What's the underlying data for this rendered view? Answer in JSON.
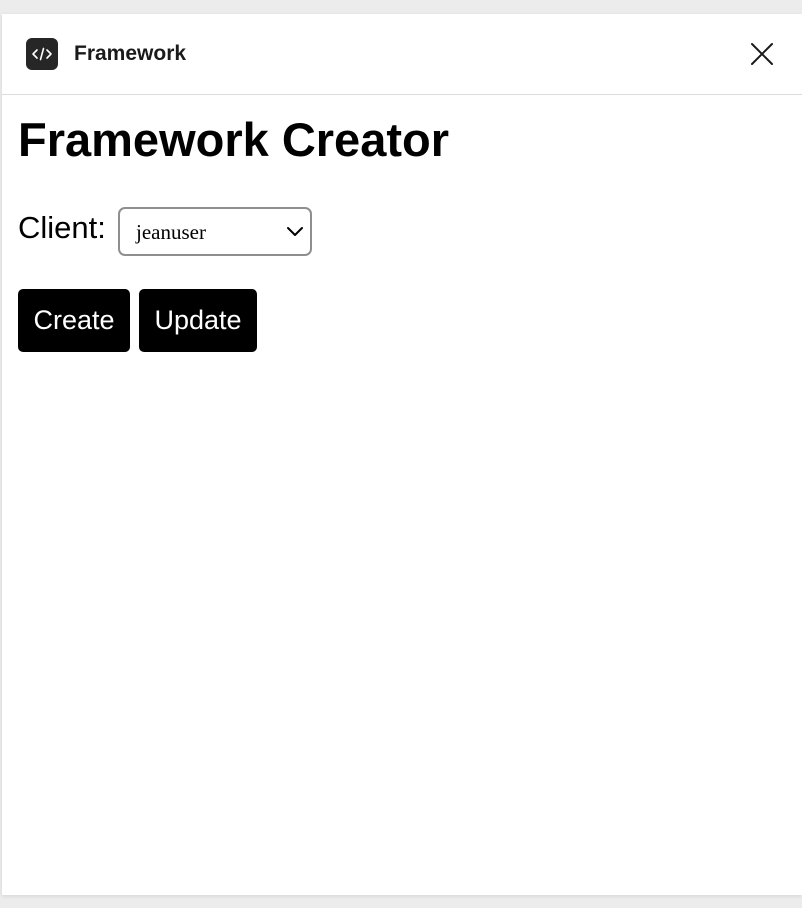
{
  "window": {
    "title": "Framework",
    "app_icon": "code-icon",
    "close_icon": "close-icon"
  },
  "main": {
    "heading": "Framework Creator",
    "client_label": "Client:",
    "client_select": {
      "selected": "jeanuser",
      "icon": "chevron-down-icon"
    },
    "buttons": {
      "create": "Create",
      "update": "Update"
    }
  }
}
